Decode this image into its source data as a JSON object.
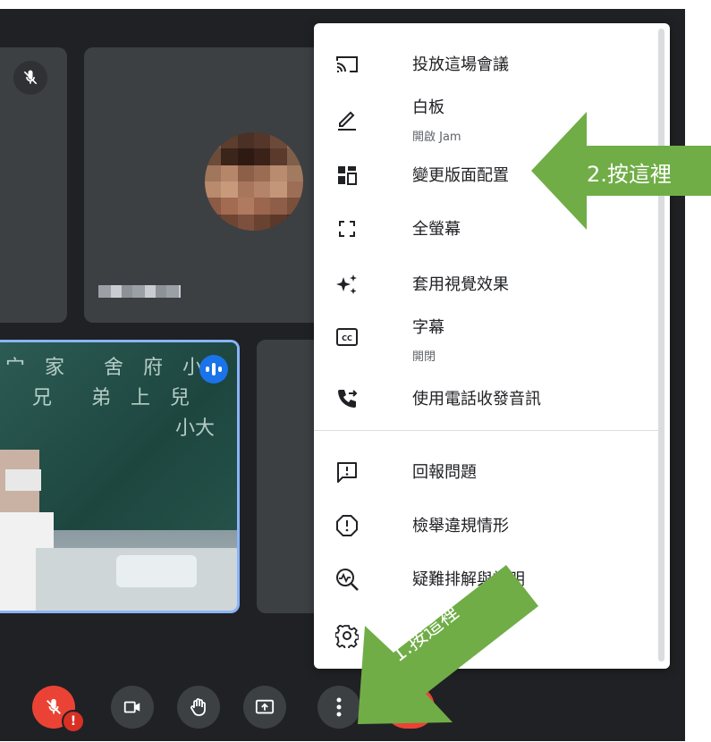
{
  "menu": {
    "items": [
      {
        "icon": "cast-icon",
        "label": "投放這場會議"
      },
      {
        "icon": "pen-icon",
        "label": "白板",
        "sub": "開啟 Jam"
      },
      {
        "icon": "layout-icon",
        "label": "變更版面配置"
      },
      {
        "icon": "fullscreen-icon",
        "label": "全螢幕"
      },
      {
        "icon": "sparkle-icon",
        "label": "套用視覺效果"
      },
      {
        "icon": "closed-caption-icon",
        "label": "字幕",
        "sub": "開閉"
      },
      {
        "icon": "phone-forward-icon",
        "label": "使用電話收發音訊"
      },
      {
        "icon": "report-problem-icon",
        "label": "回報問題"
      },
      {
        "icon": "report-abuse-icon",
        "label": "檢舉違規情形"
      },
      {
        "icon": "troubleshoot-icon",
        "label": "疑難排解與說明"
      },
      {
        "icon": "settings-icon",
        "label": ""
      }
    ]
  },
  "annotations": {
    "step1": "1.按這裡",
    "step2": "2.按這裡"
  },
  "controls": [
    {
      "icon": "mic-off-icon",
      "state": "muted"
    },
    {
      "icon": "camera-icon"
    },
    {
      "icon": "raise-hand-icon"
    },
    {
      "icon": "present-screen-icon"
    },
    {
      "icon": "more-options-icon"
    },
    {
      "icon": "end-call-icon"
    }
  ],
  "tiles": {
    "speaking_badge_icon": "audio-level-icon",
    "muted_badge_icon": "mic-off-icon",
    "warning_badge": "!"
  },
  "colors": {
    "background": "#202124",
    "tile": "#3c4043",
    "accent_blue": "#8ab4f8",
    "end_call_red": "#ea4335",
    "arrow_green": "#70ad47"
  }
}
